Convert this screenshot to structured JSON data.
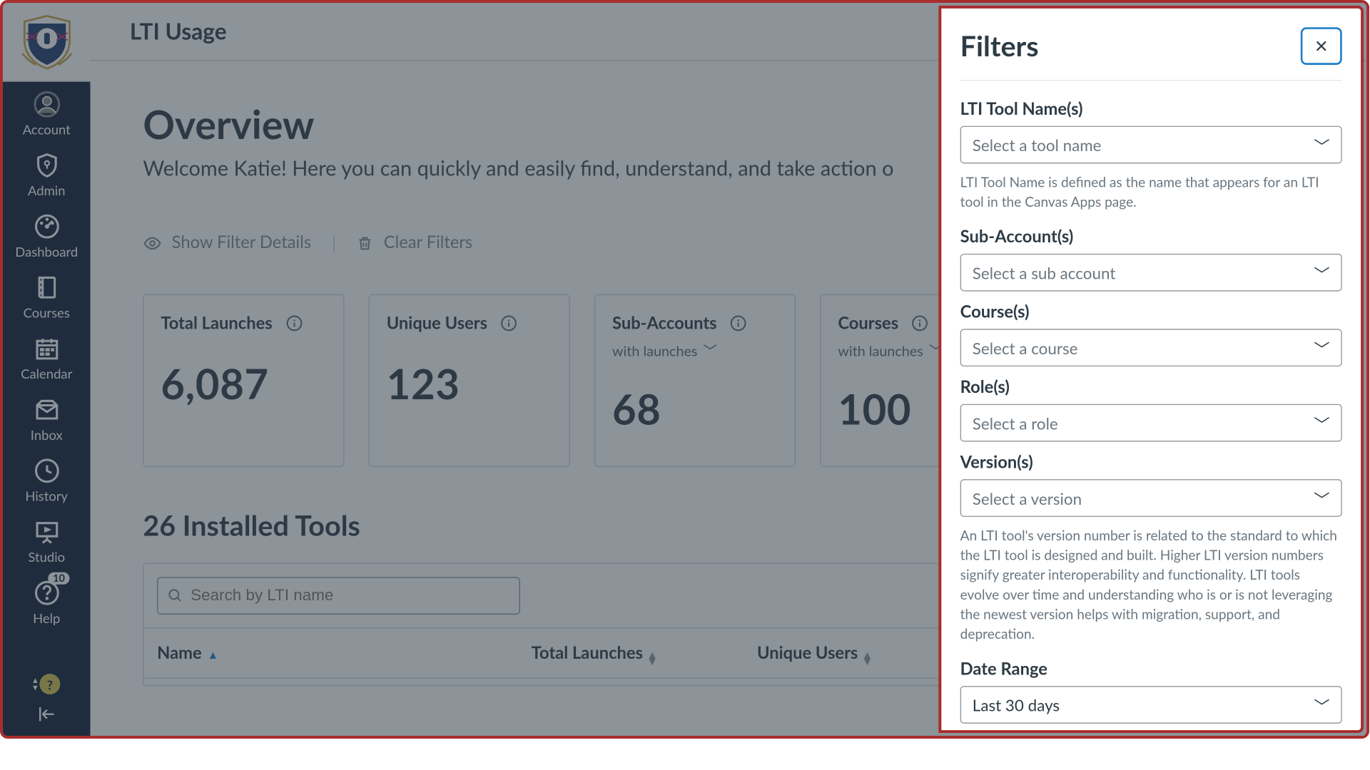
{
  "header": {
    "title": "LTI Usage"
  },
  "sidebar": {
    "items": [
      {
        "label": "Account"
      },
      {
        "label": "Admin"
      },
      {
        "label": "Dashboard"
      },
      {
        "label": "Courses"
      },
      {
        "label": "Calendar"
      },
      {
        "label": "Inbox"
      },
      {
        "label": "History"
      },
      {
        "label": "Studio"
      },
      {
        "label": "Help",
        "badge": "10"
      }
    ]
  },
  "overview": {
    "title": "Overview",
    "welcome": "Welcome Katie! Here you can quickly and easily find, understand, and take action o",
    "show_filters": "Show Filter Details",
    "clear_filters": "Clear Filters"
  },
  "cards": [
    {
      "title": "Total Launches",
      "value": "6,087",
      "subline": ""
    },
    {
      "title": "Unique Users",
      "value": "123",
      "subline": ""
    },
    {
      "title": "Sub-Accounts",
      "value": "68",
      "subline": "with launches"
    },
    {
      "title": "Courses",
      "value": "100",
      "subline": "with launches"
    }
  ],
  "installed": {
    "title": "26 Installed Tools",
    "search_placeholder": "Search by LTI name",
    "columns": {
      "name": "Name",
      "total": "Total Launches",
      "unique": "Unique Users"
    }
  },
  "panel": {
    "title": "Filters",
    "fields": {
      "tool": {
        "label": "LTI Tool Name(s)",
        "placeholder": "Select a tool name",
        "help": "LTI Tool Name is defined as the name that appears for an LTI tool in the Canvas Apps page."
      },
      "sub": {
        "label": "Sub-Account(s)",
        "placeholder": "Select a sub account"
      },
      "course": {
        "label": "Course(s)",
        "placeholder": "Select a course"
      },
      "role": {
        "label": "Role(s)",
        "placeholder": "Select a role"
      },
      "version": {
        "label": "Version(s)",
        "placeholder": "Select a version",
        "help": "An LTI tool's version number is related to the standard to which the LTI tool is designed and built. Higher LTI version numbers signify greater interoperability and functionality. LTI tools evolve over time and understanding who is or is not leveraging the newest version helps with migration, support, and deprecation."
      },
      "date": {
        "label": "Date Range",
        "value": "Last 30 days"
      }
    }
  }
}
